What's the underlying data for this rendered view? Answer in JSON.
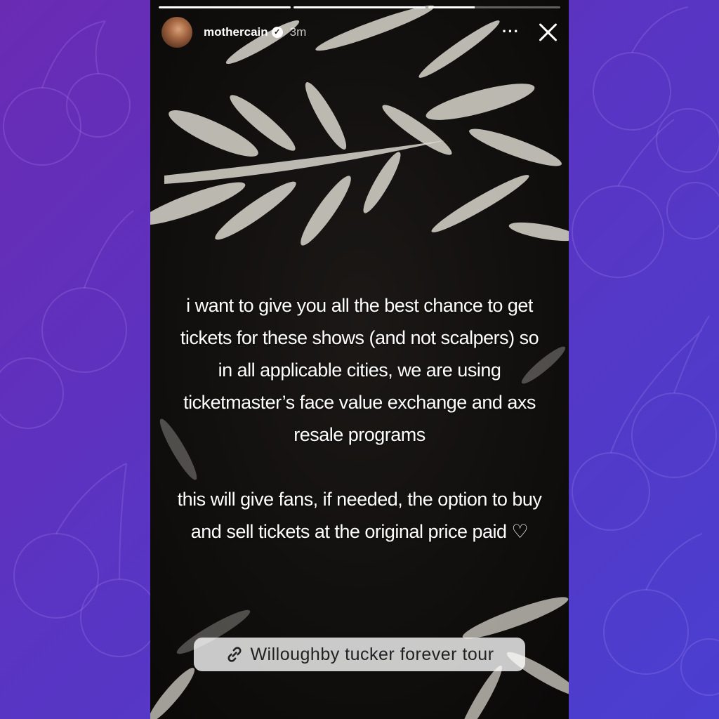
{
  "story": {
    "username": "mothercain",
    "verified_icon": "verified-badge-icon",
    "timestamp": "3m",
    "more_label": "···",
    "progress": [
      1,
      1,
      0.35
    ],
    "caption_paragraph_1": "i want to give you all the best chance to get tickets for these shows (and not scalpers) so in all applicable cities, we are using ticketmaster’s face value exchange and axs resale programs",
    "caption_paragraph_2": "this will give fans, if needed, the option to buy and sell tickets at the original price paid ♡",
    "link_sticker": {
      "icon": "link-icon",
      "label": "Willoughby tucker forever tour"
    }
  },
  "colors": {
    "background_gradient_start": "#6a2bb3",
    "background_gradient_end": "#4a3fd0",
    "story_background": "#121010"
  }
}
